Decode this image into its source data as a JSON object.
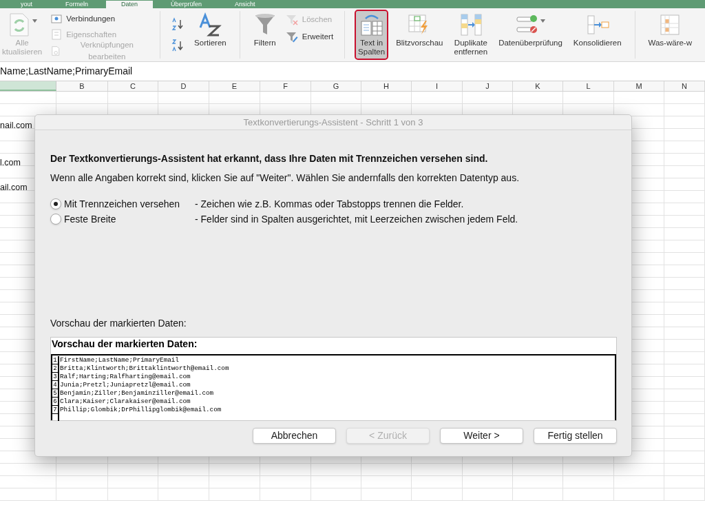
{
  "tabs": [
    {
      "label": "yout",
      "selected": false
    },
    {
      "label": "Formeln",
      "selected": false
    },
    {
      "label": "Daten",
      "selected": true
    },
    {
      "label": "Überprüfen",
      "selected": false
    },
    {
      "label": "Ansicht",
      "selected": false
    }
  ],
  "ribbon": {
    "groups": [
      {
        "items": [
          {
            "kind": "large",
            "label": "Alle\nktualisieren",
            "disabled": true,
            "selected": false,
            "dropdown": true
          },
          {
            "kind": "stack",
            "entries": [
              {
                "label": "Verbindungen",
                "disabled": false
              },
              {
                "label": "Eigenschaften",
                "disabled": true
              },
              {
                "label": "Verknüpfungen bearbeiten",
                "disabled": true
              }
            ]
          }
        ]
      },
      {
        "items": [
          {
            "kind": "sort"
          },
          {
            "kind": "large",
            "label": "Sortieren",
            "disabled": false,
            "selected": false,
            "dropdown": false
          }
        ]
      },
      {
        "items": [
          {
            "kind": "large",
            "label": "Filtern",
            "disabled": false,
            "selected": false,
            "dropdown": false
          },
          {
            "kind": "stack",
            "entries": [
              {
                "label": "Löschen",
                "disabled": true
              },
              {
                "label": "Erweitert",
                "disabled": false
              }
            ]
          }
        ]
      },
      {
        "items": [
          {
            "kind": "large",
            "label": "Text in\nSpalten",
            "disabled": false,
            "selected": true,
            "dropdown": false
          },
          {
            "kind": "large",
            "label": "Blitzvorschau",
            "disabled": false,
            "selected": false,
            "dropdown": false
          },
          {
            "kind": "large",
            "label": "Duplikate\nentfernen",
            "disabled": false,
            "selected": false,
            "dropdown": false
          },
          {
            "kind": "large",
            "label": "Datenüberprüfung",
            "disabled": false,
            "selected": false,
            "dropdown": true
          },
          {
            "kind": "large",
            "label": "Konsolidieren",
            "disabled": false,
            "selected": false,
            "dropdown": false
          }
        ]
      },
      {
        "items": [
          {
            "kind": "large",
            "label": "Was-wäre-w",
            "disabled": false,
            "selected": false,
            "dropdown": false
          }
        ]
      }
    ]
  },
  "formula_bar": {
    "value": "Name;LastName;PrimaryEmail"
  },
  "sheet": {
    "columns": [
      "B",
      "C",
      "D",
      "E",
      "F",
      "G",
      "H",
      "I",
      "J",
      "K",
      "L",
      "M",
      "N"
    ],
    "column_a": [
      {
        "text": "nail.com"
      },
      {
        "text": "l.com"
      },
      {
        "text": "ail.com"
      }
    ]
  },
  "dialog": {
    "title": "Textkonvertierungs-Assistent - Schritt 1 von 3",
    "heading": "Der Textkonvertierungs-Assistent hat erkannt, dass Ihre Daten mit Trennzeichen versehen sind.",
    "instruction": "Wenn alle Angaben korrekt sind, klicken Sie auf \"Weiter\". Wählen Sie andernfalls den korrekten Datentyp aus.",
    "options": [
      {
        "label": "Mit Trennzeichen versehen",
        "description": "- Zeichen wie z.B. Kommas oder Tabstopps trennen die Felder.",
        "selected": true
      },
      {
        "label": "Feste Breite",
        "description": "- Felder sind in Spalten ausgerichtet, mit Leerzeichen zwischen jedem Feld.",
        "selected": false
      }
    ],
    "preview_label": "Vorschau der markierten Daten:",
    "preview": {
      "title": "Vorschau der markierten Daten:",
      "lines": [
        {
          "number": "1",
          "text": "FirstName;LastName;PrimaryEmail"
        },
        {
          "number": "2",
          "text": "Britta;Klintworth;Brittaklintworth@email.com"
        },
        {
          "number": "3",
          "text": "Ralf;Harting;Ralfharting@email.com"
        },
        {
          "number": "4",
          "text": "Junia;Pretzl;Juniapretzl@email.com"
        },
        {
          "number": "5",
          "text": "Benjamin;Ziller;Benjaminziller@email.com"
        },
        {
          "number": "6",
          "text": "Clara;Kaiser;Clarakaiser@email.com"
        },
        {
          "number": "7",
          "text": "Phillip;Glombik;DrPhillipglombik@email.com"
        }
      ]
    },
    "buttons": [
      {
        "label": "Abbrechen",
        "disabled": false
      },
      {
        "label": "< Zurück",
        "disabled": true
      },
      {
        "label": "Weiter >",
        "disabled": false
      },
      {
        "label": "Fertig stellen",
        "disabled": false
      }
    ]
  }
}
